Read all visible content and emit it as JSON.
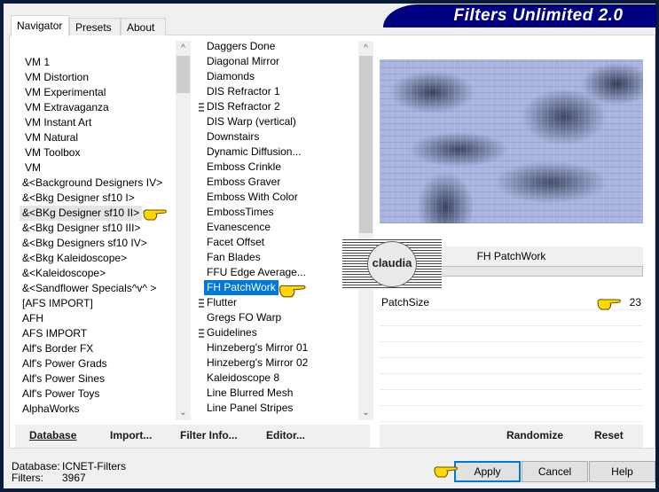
{
  "title": "Filters Unlimited 2.0",
  "tabs": [
    {
      "label": "Navigator",
      "active": true
    },
    {
      "label": "Presets",
      "active": false
    },
    {
      "label": "About",
      "active": false
    }
  ],
  "categories": {
    "items": [
      "VM 1",
      "VM Distortion",
      "VM Experimental",
      "VM Extravaganza",
      "VM Instant Art",
      "VM Natural",
      "VM Toolbox",
      "VM",
      "&<Background Designers IV>",
      "&<Bkg Designer sf10 I>",
      "&<BKg Designer sf10 II>",
      "&<Bkg Designer sf10 III>",
      "&<Bkg Designers sf10 IV>",
      "&<Bkg Kaleidoscope>",
      "&<Kaleidoscope>",
      "&<Sandflower Specials^v^ >",
      "[AFS IMPORT]",
      "AFH",
      "AFS IMPORT",
      "Alf's Border FX",
      "Alf's Power Grads",
      "Alf's Power Sines",
      "Alf's Power Toys",
      "AlphaWorks"
    ],
    "highlighted": "&<BKg Designer sf10 II>"
  },
  "filters": {
    "items": [
      {
        "label": "Daggers Done",
        "grip": false
      },
      {
        "label": "Diagonal Mirror",
        "grip": false
      },
      {
        "label": "Diamonds",
        "grip": false
      },
      {
        "label": "DIS Refractor 1",
        "grip": false
      },
      {
        "label": "DIS Refractor 2",
        "grip": true
      },
      {
        "label": "DIS Warp (vertical)",
        "grip": false
      },
      {
        "label": "Downstairs",
        "grip": false
      },
      {
        "label": "Dynamic Diffusion...",
        "grip": false
      },
      {
        "label": "Emboss Crinkle",
        "grip": false
      },
      {
        "label": "Emboss Graver",
        "grip": false
      },
      {
        "label": "Emboss With Color",
        "grip": false
      },
      {
        "label": "EmbossTimes",
        "grip": false
      },
      {
        "label": "Evanescence",
        "grip": false
      },
      {
        "label": "Facet Offset",
        "grip": false
      },
      {
        "label": "Fan Blades",
        "grip": false
      },
      {
        "label": "FFU Edge Average...",
        "grip": false
      },
      {
        "label": "FH PatchWork",
        "grip": false
      },
      {
        "label": "Flutter",
        "grip": true
      },
      {
        "label": "Gregs FO Warp",
        "grip": false
      },
      {
        "label": "Guidelines",
        "grip": true
      },
      {
        "label": "Hinzeberg's Mirror 01",
        "grip": false
      },
      {
        "label": "Hinzeberg's Mirror 02",
        "grip": false
      },
      {
        "label": "Kaleidoscope 8",
        "grip": false
      },
      {
        "label": "Line Blurred Mesh",
        "grip": false
      },
      {
        "label": "Line Panel Stripes",
        "grip": false
      }
    ],
    "selected": "FH PatchWork"
  },
  "left_buttons": {
    "database": "Database",
    "import": "Import...",
    "filter_info": "Filter Info...",
    "editor": "Editor..."
  },
  "right_panel": {
    "filter_name": "FH PatchWork",
    "params": [
      {
        "label": "PatchSize",
        "value": "23"
      }
    ],
    "randomize": "Randomize",
    "reset": "Reset"
  },
  "status": {
    "database_label": "Database:",
    "database_value": "ICNET-Filters",
    "filters_label": "Filters:",
    "filters_value": "3967"
  },
  "buttons": {
    "apply": "Apply",
    "cancel": "Cancel",
    "help": "Help"
  },
  "watermark": {
    "text": "claudia"
  },
  "colors": {
    "banner": "#000080",
    "selection": "#0078d7",
    "default_button_border": "#0078d7"
  }
}
